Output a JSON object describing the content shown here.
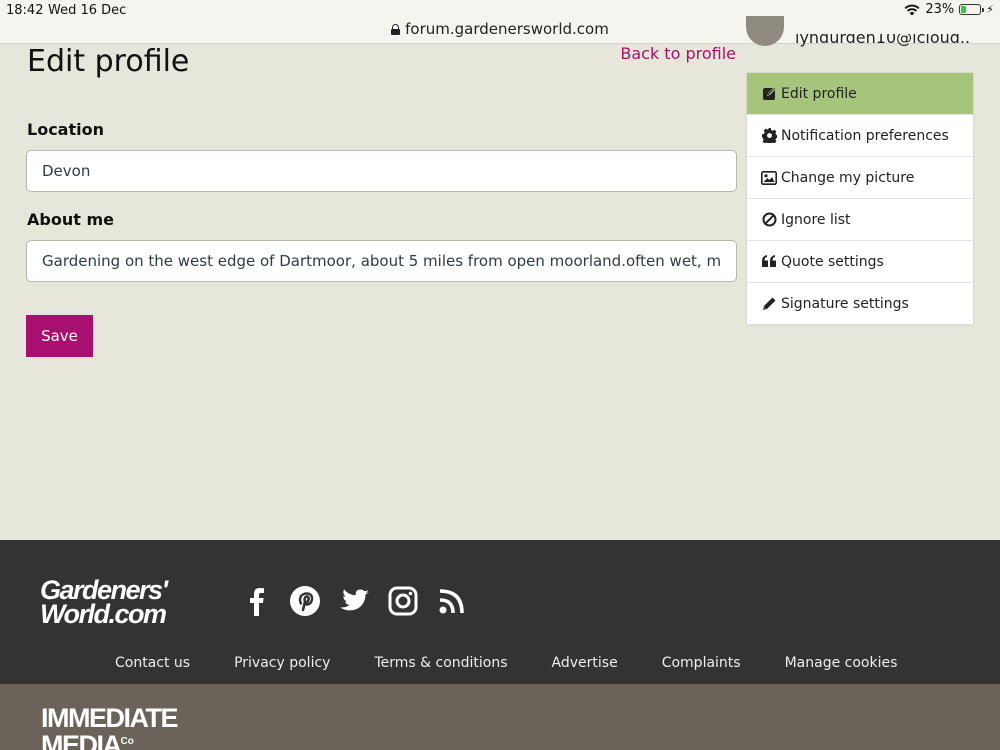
{
  "status_bar": {
    "time": "18:42",
    "date": "Wed 16 Dec",
    "url": "forum.gardenersworld.com",
    "battery": "23%"
  },
  "header": {
    "email_partial": "lyndurden10@icloud.."
  },
  "page": {
    "title": "Edit profile",
    "back_link": "Back to profile"
  },
  "form": {
    "location_label": "Location",
    "location_value": "Devon",
    "about_label": "About me",
    "about_value": "Gardening on the west edge of Dartmoor, about 5 miles from open moorland.often wet, mos",
    "save_label": "Save"
  },
  "side_menu": {
    "items": [
      {
        "label": "Edit profile",
        "icon": "edit-icon"
      },
      {
        "label": "Notification preferences",
        "icon": "gear-icon"
      },
      {
        "label": "Change my picture",
        "icon": "image-icon"
      },
      {
        "label": "Ignore list",
        "icon": "ban-icon"
      },
      {
        "label": "Quote settings",
        "icon": "quote-icon"
      },
      {
        "label": "Signature settings",
        "icon": "pencil-icon"
      }
    ]
  },
  "footer": {
    "brand_line1": "Gardeners'",
    "brand_line2": "World.com",
    "social_icons": [
      "facebook-icon",
      "pinterest-icon",
      "twitter-icon",
      "instagram-icon",
      "rss-icon"
    ],
    "links": [
      "Contact us",
      "Privacy policy",
      "Terms & conditions",
      "Advertise",
      "Complaints",
      "Manage cookies"
    ],
    "publisher_line1": "IMMEDIATE",
    "publisher_line2": "MEDIA",
    "publisher_suffix": "Co"
  },
  "colors": {
    "accent": "#a90f6e",
    "active_menu": "#a7c47d",
    "background": "#e6e6db",
    "footer": "#333333"
  }
}
